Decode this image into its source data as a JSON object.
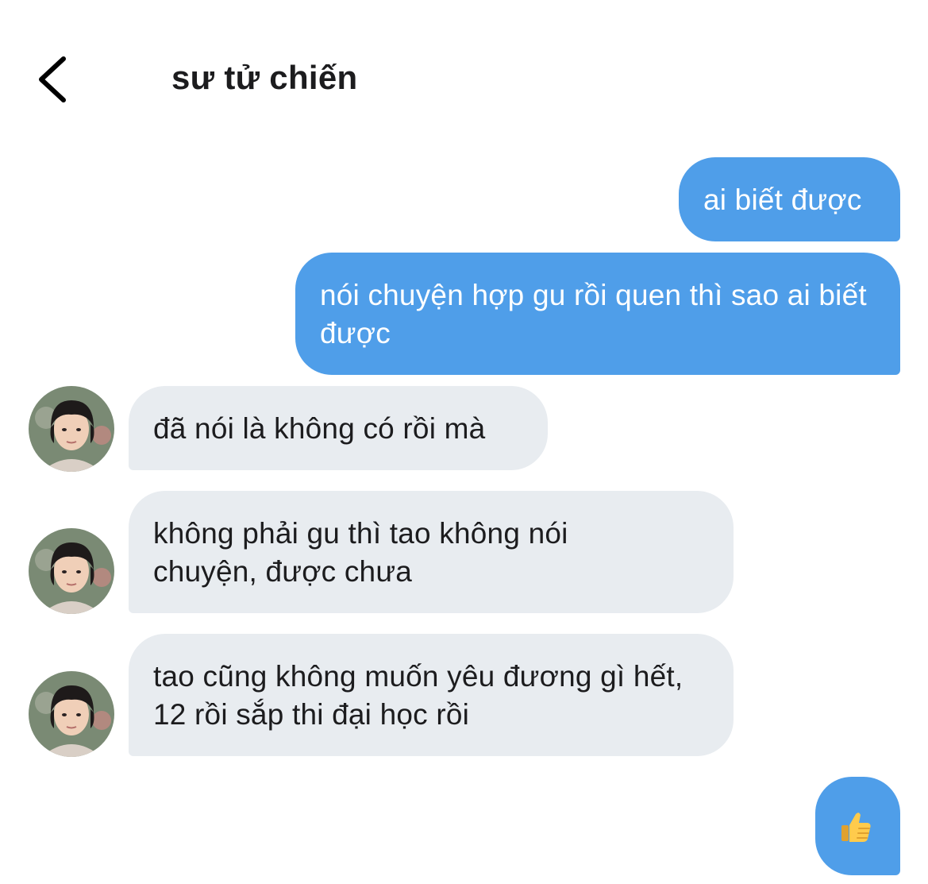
{
  "header": {
    "title": "sư tử chiến",
    "back_icon": "chevron-left-icon"
  },
  "messages": [
    {
      "sender": "me",
      "text": "ai biết được"
    },
    {
      "sender": "me",
      "text": "nói chuyện hợp gu rồi quen thì sao ai biết được"
    },
    {
      "sender": "them",
      "text": "đã nói là không có rồi mà"
    },
    {
      "sender": "them",
      "text": "không phải gu thì tao không nói chuyện, được chưa"
    },
    {
      "sender": "them",
      "text": "tao cũng không muốn yêu đương gì hết, 12 rồi sắp thi đại học rồi"
    },
    {
      "sender": "me",
      "emoji": "👍",
      "icon": "thumbs-up-icon"
    }
  ],
  "colors": {
    "outgoing_bubble": "#4f9ee9",
    "incoming_bubble": "#e8ecf0",
    "outgoing_text": "#ffffff",
    "incoming_text": "#1c1c1e"
  }
}
